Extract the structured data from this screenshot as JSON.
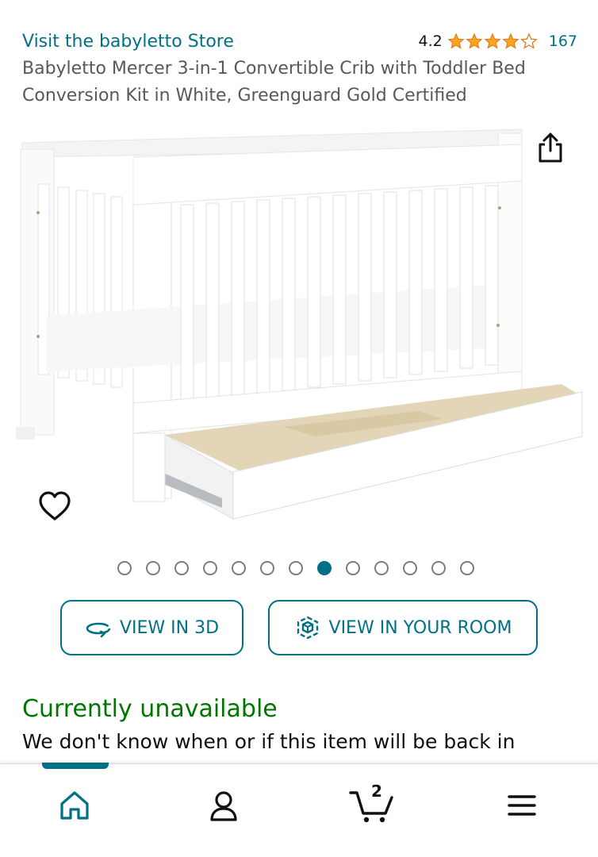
{
  "header": {
    "store_link": "Visit the babyletto Store",
    "rating_value": "4.2",
    "rating_stars": 4.2,
    "rating_count": "167",
    "star_color": "#FFA41C"
  },
  "product": {
    "title": "Babyletto Mercer 3-in-1 Convertible Crib with Toddler Bed Conversion Kit in White, Greenguard Gold Certified",
    "image_alt": "White convertible crib with open under-crib storage drawer"
  },
  "gallery": {
    "total_images": 13,
    "active_index": 8,
    "share_icon": "share-icon",
    "wishlist_icon": "heart-icon"
  },
  "actions": {
    "view_3d_label": "VIEW IN 3D",
    "view_room_label": "VIEW IN YOUR ROOM"
  },
  "availability": {
    "status": "Currently unavailable",
    "message": "We don't know when or if this item will be back in",
    "status_color": "#007600"
  },
  "bottom_nav": {
    "items": [
      "home-icon",
      "account-icon",
      "cart-icon",
      "menu-icon"
    ],
    "cart_count": "2",
    "active_item": "home-icon",
    "accent": "#007185"
  }
}
